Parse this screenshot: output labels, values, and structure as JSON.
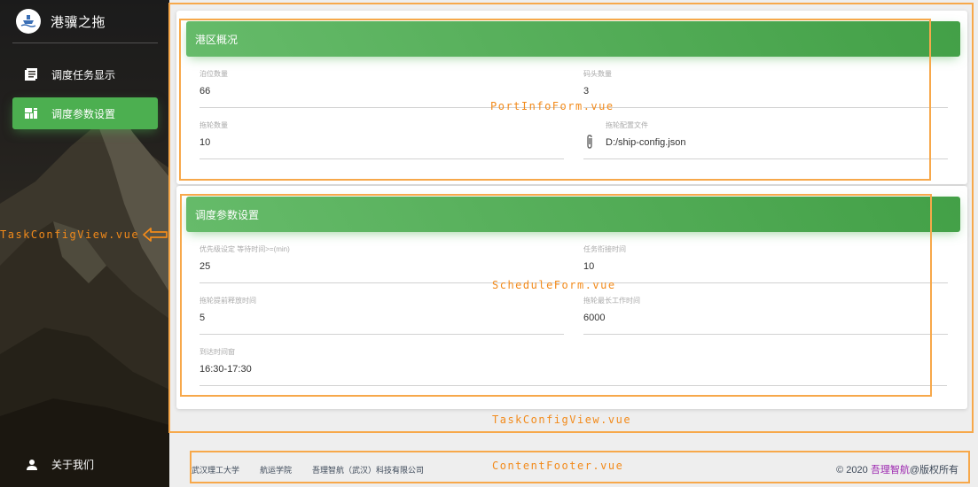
{
  "sidebar": {
    "brand_title": "港骥之拖",
    "brand_icon": "ship-logo-icon",
    "items": [
      {
        "label": "调度任务显示",
        "icon": "list-icon",
        "active": false
      },
      {
        "label": "调度参数设置",
        "icon": "dashboard-icon",
        "active": true
      }
    ],
    "about_label": "关于我们",
    "about_icon": "person-icon"
  },
  "port_card": {
    "header": "港区概况",
    "fields": [
      {
        "label": "泊位数量",
        "value": "66"
      },
      {
        "label": "码头数量",
        "value": "3"
      },
      {
        "label": "拖轮数量",
        "value": "10"
      },
      {
        "label": "拖轮配置文件",
        "value": "D:/ship-config.json",
        "icon": "paperclip-icon"
      }
    ]
  },
  "schedule_card": {
    "header": "调度参数设置",
    "fields": [
      {
        "label": "优先级设定 等待时间>=(min)",
        "value": "25"
      },
      {
        "label": "任务衔接时间",
        "value": "10"
      },
      {
        "label": "拖轮提前释放时间",
        "value": "5"
      },
      {
        "label": "拖轮最长工作时间",
        "value": "6000"
      },
      {
        "label": "到达时间窗",
        "value": "16:30-17:30"
      }
    ]
  },
  "footer": {
    "links": [
      "武汉理工大学",
      "航运学院",
      "吾理智航（武汉）科技有限公司"
    ],
    "copyright_prefix": "© 2020 ",
    "copyright_brand": "吾理智航",
    "copyright_suffix": "@版权所有"
  },
  "annotations": {
    "port_info_form": "PortInfoForm.vue",
    "schedule_form": "ScheduleForm.vue",
    "task_config_view": "TaskConfigView.vue",
    "task_config_view_side": "TaskConfigView.vue",
    "content_footer": "ContentFooter.vue"
  },
  "colors": {
    "accent_green": "#4caf50",
    "annotation_orange": "#f7a84a",
    "copyright_brand": "#9c27b0"
  }
}
